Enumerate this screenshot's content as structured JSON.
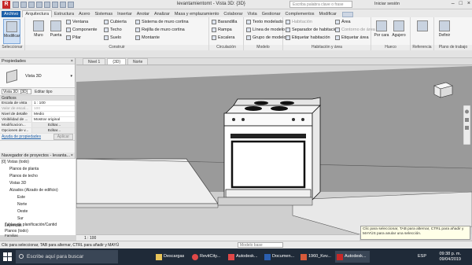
{
  "window": {
    "title": "levantamientomt - Vista 3D: {3D}",
    "search_placeholder": "Escriba palabra clave o frase",
    "sign_in": "Iniciar sesión"
  },
  "tabs": [
    "Archivo",
    "Arquitectura",
    "Estructura",
    "Acero",
    "Sistemas",
    "Insertar",
    "Anotar",
    "Analizar",
    "Masa y emplazamiento",
    "Colaborar",
    "Vista",
    "Gestionar",
    "Complementos",
    "Modificar"
  ],
  "ribbon": {
    "select": {
      "modify": "Modificar",
      "label": "Seleccionar"
    },
    "build": {
      "wall": "Muro",
      "door": "Puerta",
      "window": "Ventana",
      "component": "Componente",
      "column": "Pilar",
      "roof": "Cubierta",
      "ceiling": "Techo",
      "floor": "Suelo",
      "curtain_system": "Sistema de muro cortina",
      "curtain_grid": "Rejilla de muro cortina",
      "mullion": "Montante",
      "label": "Construir"
    },
    "circulation": {
      "railing": "Barandilla",
      "ramp": "Rampa",
      "stair": "Escalera",
      "label": "Circulación"
    },
    "model": {
      "model_text": "Texto modelado",
      "model_line": "Línea de modelo",
      "model_group": "Grupo de modelos",
      "label": "Modelo"
    },
    "room": {
      "room": "Habitación",
      "room_separator": "Separador de habitación",
      "tag_room": "Etiquetar habitación",
      "area": "Área",
      "area_boundary": "Contorno de área",
      "tag_area": "Etiquetar área",
      "label": "Habitación y área"
    },
    "opening": {
      "by_face": "Por cara",
      "shaft": "Agujero",
      "label": "Hueco"
    },
    "datum": {
      "label": "Referencia"
    },
    "work_plane": {
      "set": "Definir",
      "label": "Plano de trabajo"
    }
  },
  "properties": {
    "header": "Propiedades",
    "type_name": "Vista 3D",
    "view_selector": "Vista 3D: {3D}",
    "edit_type": "Editar tipo",
    "section": "Gráficos",
    "rows": [
      {
        "k": "Escala de vista",
        "v": "1 : 100"
      },
      {
        "k": "Valor de escal...",
        "v": "100"
      },
      {
        "k": "Nivel de detalle",
        "v": "Medio"
      },
      {
        "k": "Visibilidad de ...",
        "v": "Mostrar original"
      },
      {
        "k": "Modificacion...",
        "v": "Editar..."
      },
      {
        "k": "Opciones de v...",
        "v": "Editar..."
      }
    ],
    "help_link": "Ayuda de propiedades",
    "apply": "Aplicar"
  },
  "browser": {
    "header": "Navegador de proyectos - levanta...",
    "items": [
      "[0] Vistas (todo)",
      "Planos de planta",
      "Planos de techo",
      "Vistas 3D",
      "Alzados (Alzado de edificio)",
      "Este",
      "Norte",
      "Oeste",
      "Sur",
      "Leyendas",
      "Tablas de planificación/Cantid",
      "Planos (todo)",
      "Familias"
    ]
  },
  "view_tabs": [
    "Nivel 1",
    "{3D}",
    "Norte"
  ],
  "view_control": {
    "scale": "1 : 100"
  },
  "tooltip": "Clic para seleccionar, TAB para alternar, CTRL para añadir y MAYÚS para anular una selección.",
  "status": {
    "message": "Clic para seleccionar, TAB para alternar, CTRL para añadir y MAYÚ",
    "model": "Modelo base"
  },
  "taskbar": {
    "search": "Escribe aquí para buscar",
    "items": [
      "Descargas",
      "RevitCity...",
      "Autodesk...",
      "Documen...",
      "1960_Kev...",
      "Autodesk..."
    ],
    "lang": "ESP",
    "time": "09:38 p. m.",
    "date": "09/04/2019"
  }
}
